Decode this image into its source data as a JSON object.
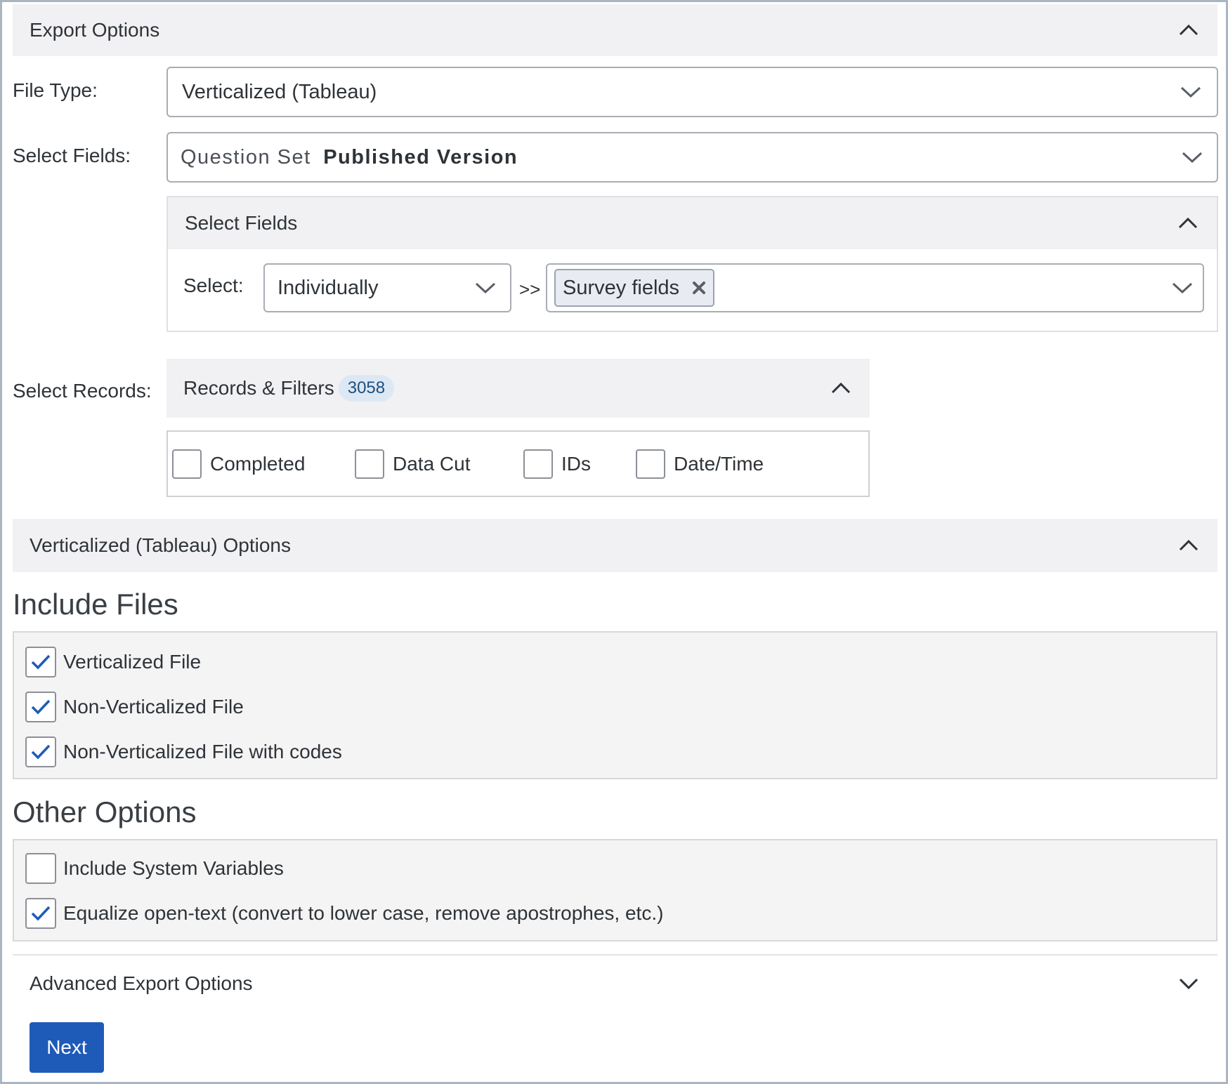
{
  "export_options": {
    "title": "Export Options"
  },
  "file_type": {
    "label": "File Type:",
    "value": "Verticalized (Tableau)"
  },
  "select_fields": {
    "label": "Select Fields:",
    "prefix": "Question Set",
    "value": "Published Version",
    "panel_title": "Select Fields",
    "select_label": "Select:",
    "select_value": "Individually",
    "arrow": ">>",
    "tag": "Survey fields"
  },
  "select_records": {
    "label": "Select Records:",
    "panel_title": "Records & Filters",
    "count": "3058",
    "filters": [
      {
        "label": "Completed",
        "checked": false
      },
      {
        "label": "Data Cut",
        "checked": false
      },
      {
        "label": "IDs",
        "checked": false
      },
      {
        "label": "Date/Time",
        "checked": false
      }
    ]
  },
  "tableau_options": {
    "title": "Verticalized (Tableau) Options"
  },
  "include_files": {
    "heading": "Include Files",
    "items": [
      {
        "label": "Verticalized File",
        "checked": true
      },
      {
        "label": "Non-Verticalized File",
        "checked": true
      },
      {
        "label": "Non-Verticalized File with codes",
        "checked": true
      }
    ]
  },
  "other_options": {
    "heading": "Other Options",
    "items": [
      {
        "label": "Include System Variables",
        "checked": false
      },
      {
        "label": "Equalize open-text (convert to lower case, remove apostrophes, etc.)",
        "checked": true
      }
    ]
  },
  "advanced": {
    "title": "Advanced Export Options"
  },
  "actions": {
    "next_label": "Next"
  },
  "colors": {
    "accent": "#1e5bb8",
    "section_bg": "#f1f1f3",
    "check": "#1e5bb8"
  }
}
